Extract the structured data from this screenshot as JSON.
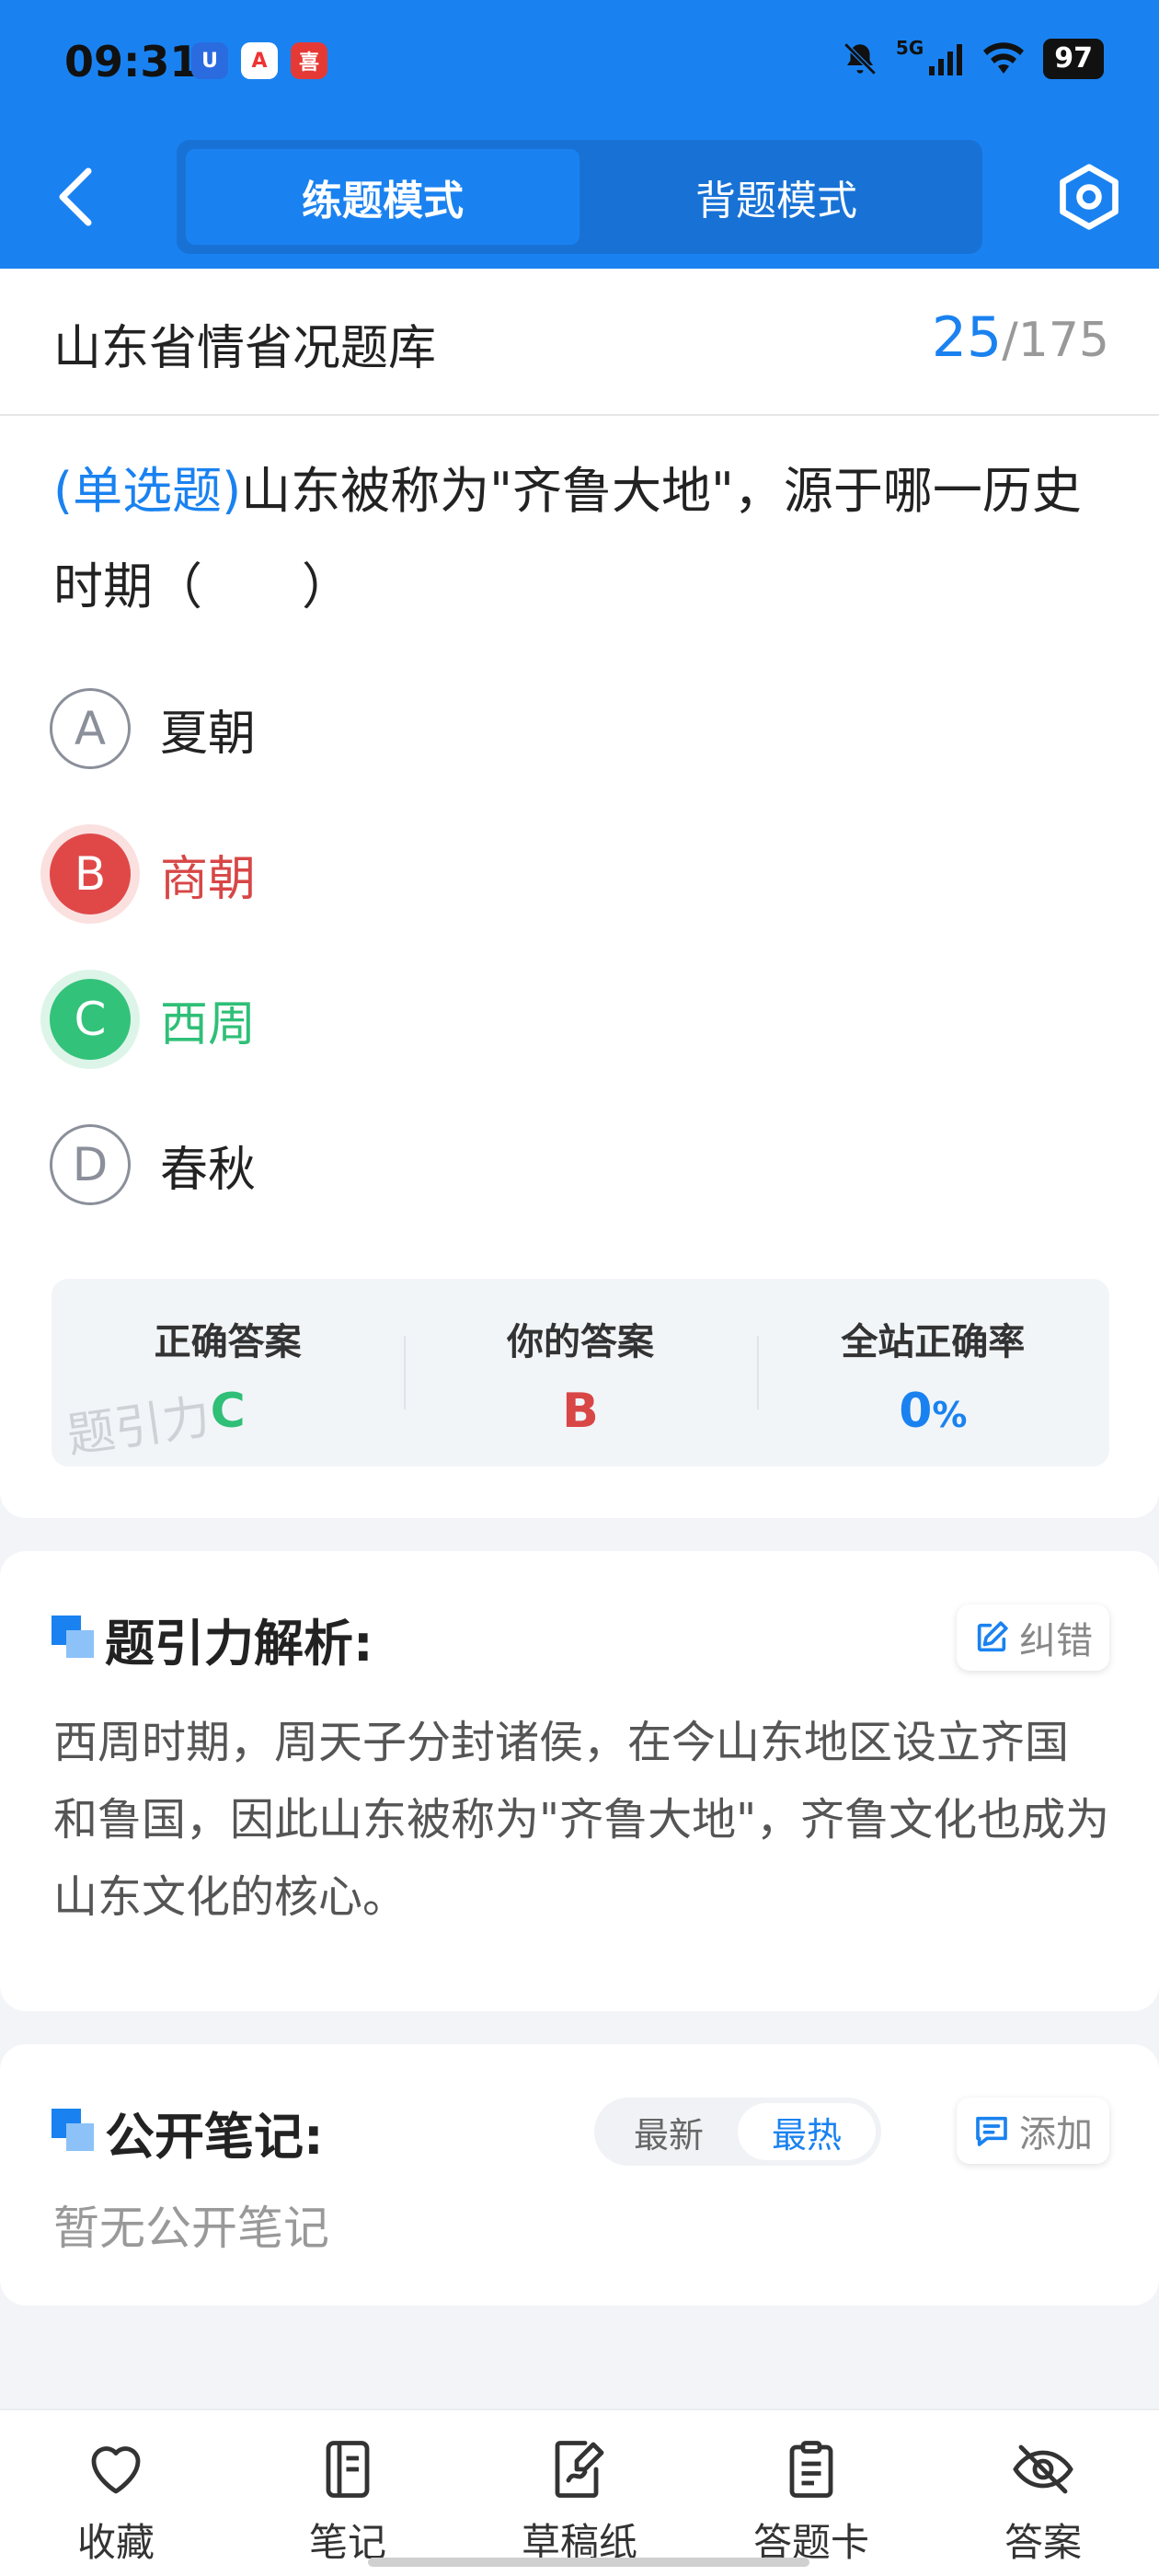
{
  "status_bar": {
    "time": "09:31",
    "network": "5G",
    "battery": "97"
  },
  "nav": {
    "modes": [
      "练题模式",
      "背题模式"
    ],
    "active_mode": "练题模式"
  },
  "bank": {
    "title": "山东省情省况题库",
    "current": "25",
    "separator": "/",
    "total": "175"
  },
  "question": {
    "type": "(单选题)",
    "text": "山东被称为\"齐鲁大地\"，源于哪一历史时期（　　）",
    "options": [
      {
        "letter": "A",
        "text": "夏朝",
        "state": "normal"
      },
      {
        "letter": "B",
        "text": "商朝",
        "state": "wrong"
      },
      {
        "letter": "C",
        "text": "西周",
        "state": "correct"
      },
      {
        "letter": "D",
        "text": "春秋",
        "state": "normal"
      }
    ]
  },
  "result": {
    "correct_label": "正确答案",
    "correct_value": "C",
    "your_label": "你的答案",
    "your_value": "B",
    "rate_label": "全站正确率",
    "rate_value": "0",
    "rate_unit": "%",
    "watermark": "题引力"
  },
  "analysis": {
    "title": "题引力解析:",
    "correct_button": "纠错",
    "text": "西周时期，周天子分封诸侯，在今山东地区设立齐国和鲁国，因此山东被称为\"齐鲁大地\"，齐鲁文化也成为山东文化的核心。"
  },
  "notes": {
    "title": "公开笔记:",
    "sort_options": [
      "最新",
      "最热"
    ],
    "active_sort": "最热",
    "add_button": "添加",
    "empty_text": "暂无公开笔记"
  },
  "bottom_tabs": [
    {
      "label": "收藏",
      "icon": "heart-icon"
    },
    {
      "label": "笔记",
      "icon": "notebook-icon"
    },
    {
      "label": "草稿纸",
      "icon": "draft-paper-icon"
    },
    {
      "label": "答题卡",
      "icon": "answer-sheet-icon"
    },
    {
      "label": "答案",
      "icon": "eye-off-icon"
    }
  ],
  "colors": {
    "primary": "#1a82f0",
    "correct": "#33c27a",
    "wrong": "#e04848"
  }
}
